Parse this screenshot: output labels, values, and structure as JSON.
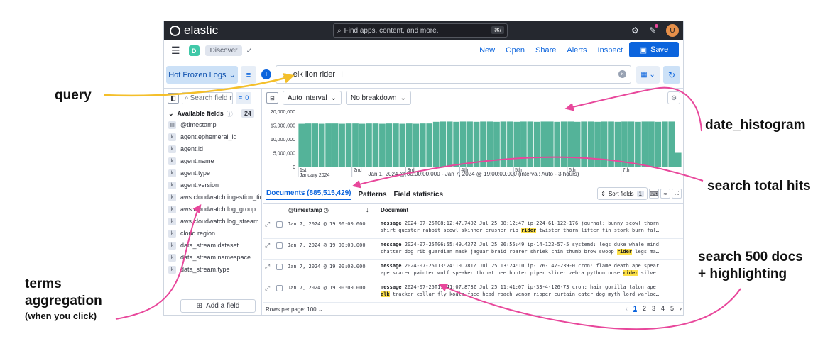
{
  "annotations": {
    "query": "query",
    "date_histogram": "date_histogram",
    "search_total_hits": "search total hits",
    "search_docs_line1": "search 500 docs",
    "search_docs_line2": "+ highlighting",
    "terms_line1": "terms",
    "terms_line2": "aggregation",
    "terms_line3": "(when you click)",
    "colors": {
      "yellow_arrow": "#f4bf2a",
      "pink_arrow": "#e8479b"
    }
  },
  "topbar": {
    "logo_text": "elastic",
    "search_placeholder": "Find apps, content, and more.",
    "search_shortcut": "⌘/",
    "avatar_initial": "U"
  },
  "navbar": {
    "space_initial": "D",
    "breadcrumb": "Discover",
    "links": [
      "New",
      "Open",
      "Share",
      "Alerts",
      "Inspect"
    ],
    "save_label": "Save"
  },
  "querybar": {
    "data_view": "Hot Frozen Logs",
    "query": "elk lion rider"
  },
  "sidebar": {
    "search_placeholder": "Search field names",
    "filter_count": "0",
    "available_label": "Available fields",
    "available_count": "24",
    "fields": [
      {
        "type": "date",
        "name": "@timestamp"
      },
      {
        "type": "k",
        "name": "agent.ephemeral_id"
      },
      {
        "type": "k",
        "name": "agent.id"
      },
      {
        "type": "k",
        "name": "agent.name"
      },
      {
        "type": "k",
        "name": "agent.type"
      },
      {
        "type": "k",
        "name": "agent.version"
      },
      {
        "type": "k",
        "name": "aws.cloudwatch.ingestion_time"
      },
      {
        "type": "k",
        "name": "aws.cloudwatch.log_group"
      },
      {
        "type": "k",
        "name": "aws.cloudwatch.log_stream"
      },
      {
        "type": "k",
        "name": "cloud.region"
      },
      {
        "type": "k",
        "name": "data_stream.dataset"
      },
      {
        "type": "k",
        "name": "data_stream.namespace"
      },
      {
        "type": "k",
        "name": "data_stream.type"
      }
    ],
    "add_field_label": "Add a field"
  },
  "chart_controls": {
    "interval": "Auto interval",
    "breakdown": "No breakdown"
  },
  "chart_data": {
    "type": "bar",
    "color": "#54b399",
    "ylim": [
      0,
      20000000
    ],
    "y_ticks": [
      "20,000,000",
      "15,000,000",
      "10,000,000",
      "5,000,000",
      "0"
    ],
    "x_ticks": [
      {
        "label": "1st",
        "sub": "January 2024",
        "day": 0
      },
      {
        "label": "2nd",
        "sub": "",
        "day": 1
      },
      {
        "label": "3rd",
        "sub": "",
        "day": 2
      },
      {
        "label": "4th",
        "sub": "",
        "day": 3
      },
      {
        "label": "5th",
        "sub": "",
        "day": 4
      },
      {
        "label": "6th",
        "sub": "",
        "day": 5
      },
      {
        "label": "7th",
        "sub": "",
        "day": 6
      }
    ],
    "interval_hours": 3,
    "values": [
      15500000,
      15600000,
      15600000,
      15500000,
      15600000,
      15600000,
      15500000,
      15600000,
      15600000,
      15500000,
      15600000,
      15600000,
      15500000,
      15600000,
      15600000,
      15500000,
      15600000,
      15500000,
      15600000,
      15600000,
      16200000,
      16300000,
      16300000,
      16200000,
      16300000,
      16300000,
      16200000,
      16300000,
      16300000,
      16200000,
      16300000,
      16300000,
      16200000,
      16300000,
      16300000,
      16200000,
      16300000,
      16300000,
      16200000,
      16300000,
      16300000,
      16200000,
      16300000,
      16300000,
      16200000,
      16300000,
      16300000,
      16200000,
      16300000,
      16300000,
      16200000,
      16300000,
      16300000,
      16200000,
      16300000,
      16300000,
      5000000
    ],
    "caption": "Jan 1, 2024 @ 00:00:00.000 - Jan 7, 2024 @ 19:00:00.000 (interval: Auto - 3 hours)"
  },
  "tabs": {
    "documents": "Documents (885,515,429)",
    "patterns": "Patterns",
    "field_stats": "Field statistics",
    "sort_fields": "Sort fields",
    "sort_count": "1"
  },
  "table": {
    "col_timestamp": "@timestamp",
    "col_document": "Document",
    "rows": [
      {
        "ts": "Jan 7, 2024 @ 19:00:00.000",
        "line1": [
          {
            "t": "message",
            "s": "b"
          },
          {
            "t": " 2024-07-25T08:12:47.740Z Jul 25 08:12:47 ip-224-61-122-176 journal: bunny scowl thorn",
            "s": ""
          }
        ],
        "line2": [
          {
            "t": "shirt quester rabbit scowl skinner crusher rib ",
            "s": ""
          },
          {
            "t": "rider",
            "s": "hl"
          },
          {
            "t": " twister thorn lifter fin stork burn fal…",
            "s": ""
          }
        ]
      },
      {
        "ts": "Jan 7, 2024 @ 19:00:00.000",
        "line1": [
          {
            "t": "message",
            "s": "b"
          },
          {
            "t": " 2024-07-25T06:55:49.437Z Jul 25 06:55:49 ip-14-122-57-5 systemd: legs duke whale mind",
            "s": ""
          }
        ],
        "line2": [
          {
            "t": "chatter dog rib guardian mask jaguar braid roarer shriek chin thumb brow swoop ",
            "s": ""
          },
          {
            "t": "rider",
            "s": "hl"
          },
          {
            "t": " legs ma…",
            "s": ""
          }
        ]
      },
      {
        "ts": "Jan 7, 2024 @ 19:00:00.000",
        "line1": [
          {
            "t": "message",
            "s": "b"
          },
          {
            "t": " 2024-07-25T13:24:10.781Z Jul 25 13:24:10 ip-176-147-239-0 cron: flame death ape spear",
            "s": ""
          }
        ],
        "line2": [
          {
            "t": "ape scarer painter wolf speaker throat bee hunter piper slicer zebra python nose ",
            "s": ""
          },
          {
            "t": "rider",
            "s": "hl"
          },
          {
            "t": " silve…",
            "s": ""
          }
        ]
      },
      {
        "ts": "Jan 7, 2024 @ 19:00:00.000",
        "line1": [
          {
            "t": "message",
            "s": "b"
          },
          {
            "t": " 2024-07-25T11:41:07.873Z Jul 25 11:41:07 ip-33-4-126-73 cron: hair gorilla talon ape",
            "s": ""
          }
        ],
        "line2": [
          {
            "t": "elk",
            "s": "hl"
          },
          {
            "t": " tracker collar fly koala face head roach venom ripper curtain eater dog myth lord warloc…",
            "s": ""
          }
        ]
      }
    ]
  },
  "footer": {
    "rows_per_page": "Rows per page: 100",
    "pages": [
      "1",
      "2",
      "3",
      "4",
      "5"
    ],
    "current_page": "1"
  }
}
